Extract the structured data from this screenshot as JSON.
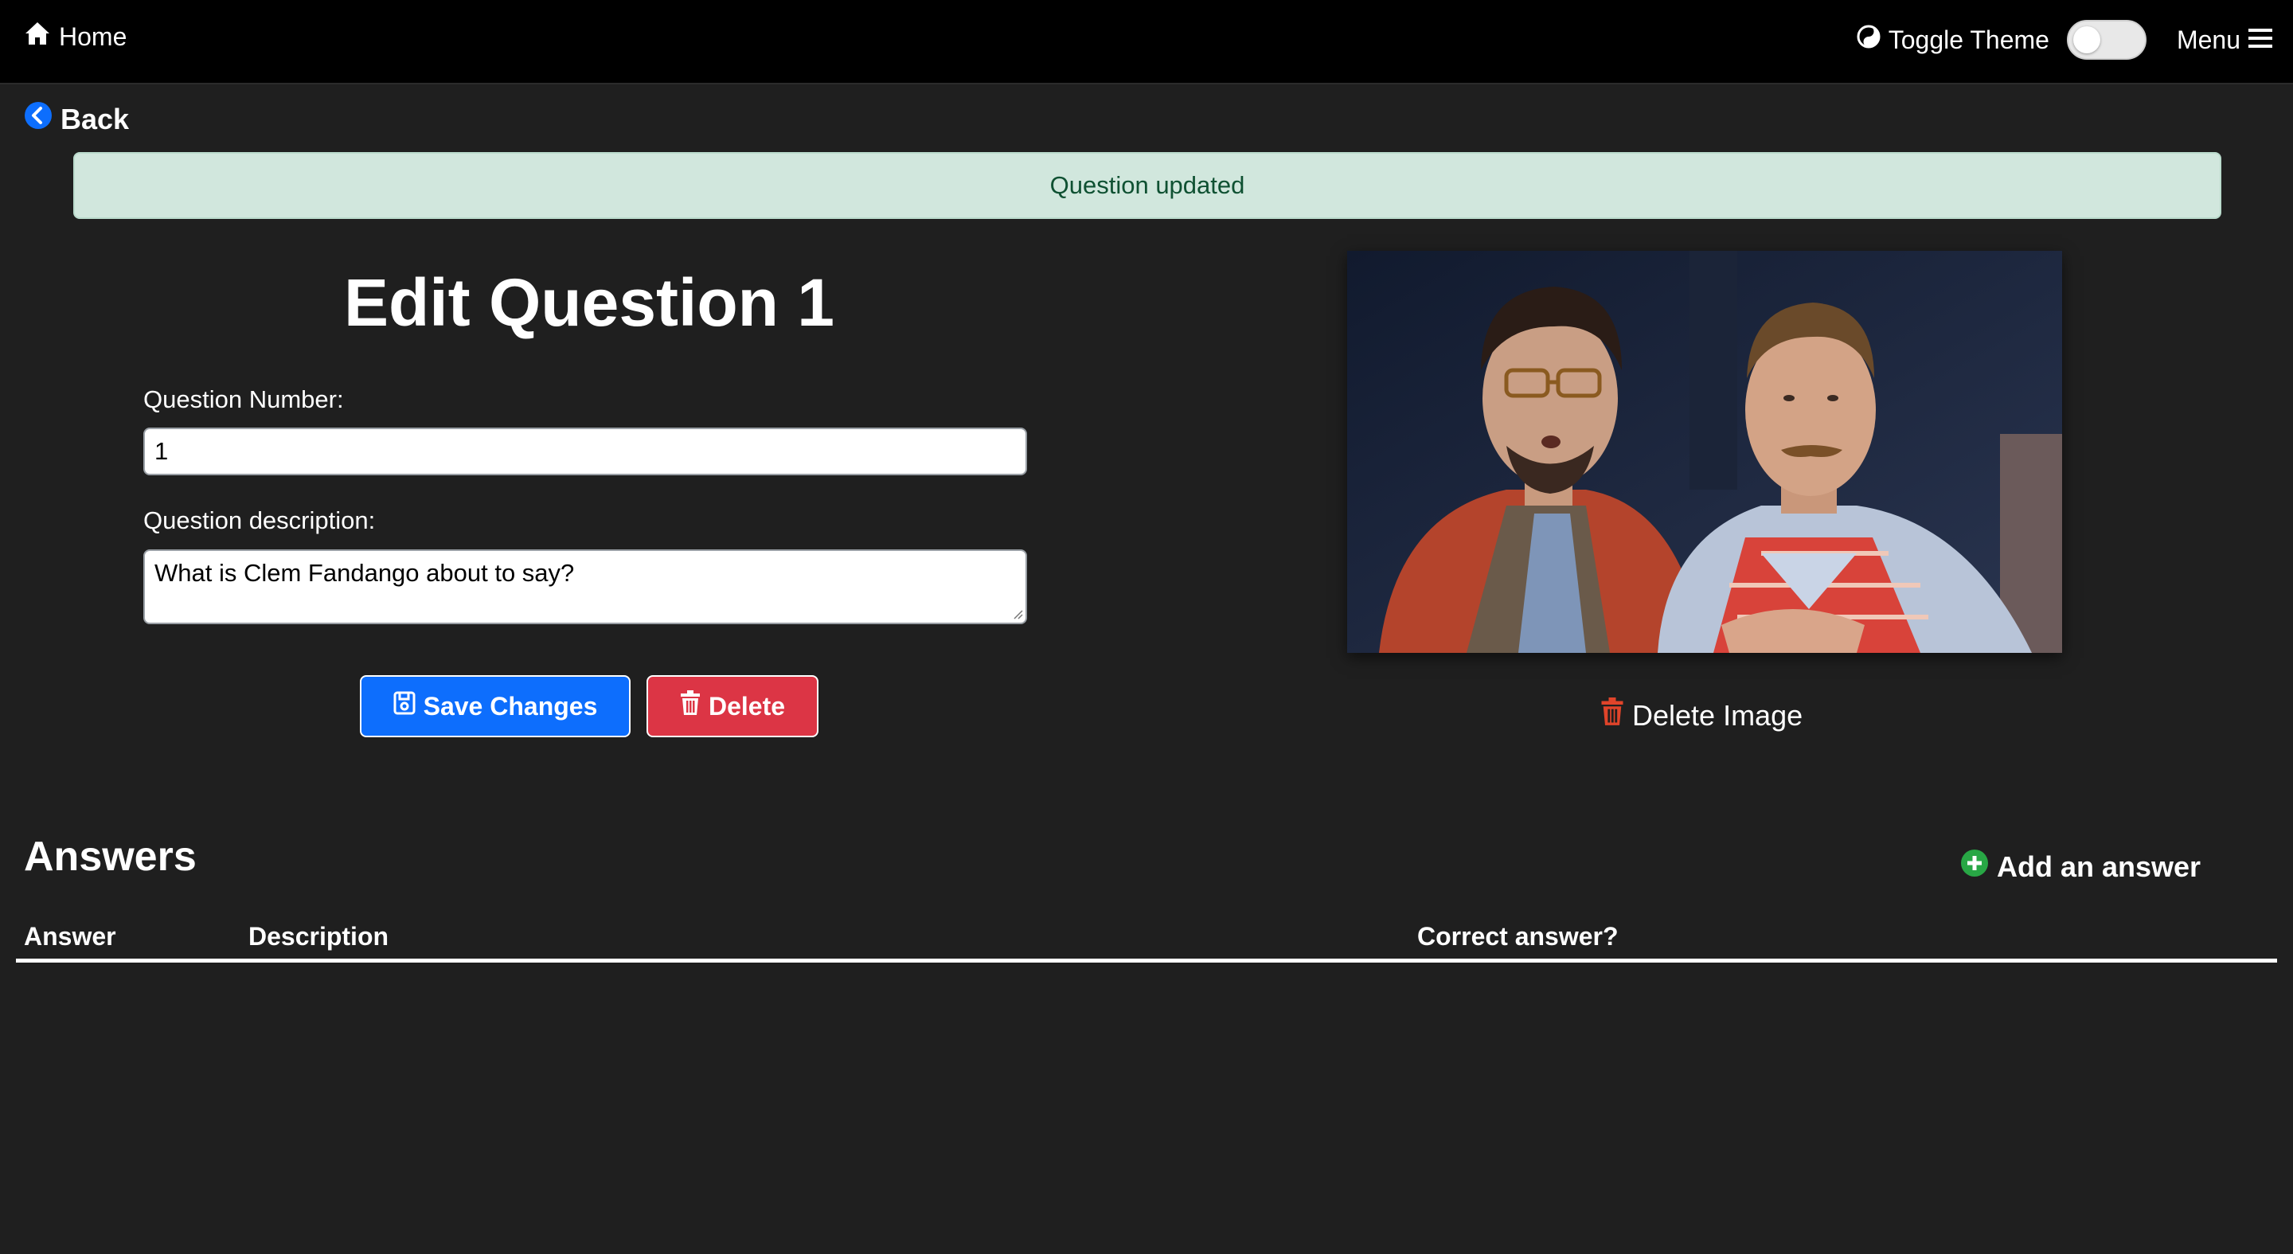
{
  "nav": {
    "home_label": "Home",
    "toggle_label": "Toggle Theme",
    "menu_label": "Menu"
  },
  "back_label": "Back",
  "alert": {
    "message": "Question updated"
  },
  "form": {
    "title": "Edit Question 1",
    "number_label": "Question Number:",
    "number_value": "1",
    "description_label": "Question description:",
    "description_value": "What is Clem Fandango about to say?",
    "save_label": "Save Changes",
    "delete_label": "Delete"
  },
  "image": {
    "delete_label": "Delete Image"
  },
  "answers": {
    "title": "Answers",
    "add_label": "Add an answer",
    "columns": [
      "Answer",
      "Description",
      "Correct answer?"
    ]
  },
  "colors": {
    "background": "#1f1f1f",
    "navbar": "#000000",
    "primary": "#0d6efd",
    "danger": "#dc3545",
    "success": "#28a745",
    "alert_bg": "#d1e7dd",
    "alert_text": "#0f5132"
  }
}
